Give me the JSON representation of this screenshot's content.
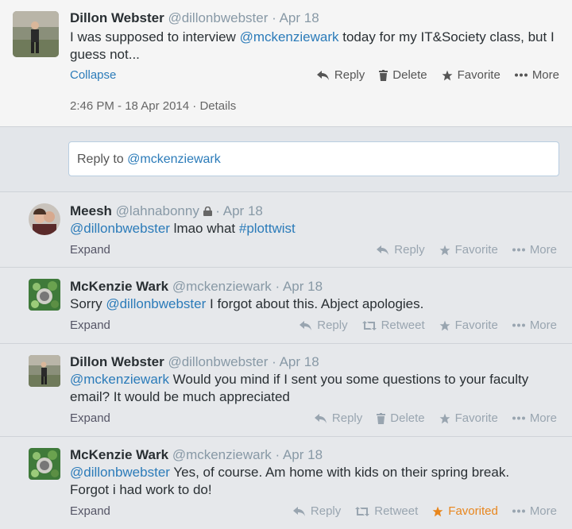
{
  "main": {
    "name": "Dillon Webster",
    "handle": "@dillonbwebster",
    "date": "Apr 18",
    "text_before": "I was supposed to interview ",
    "mention": "@mckenziewark",
    "text_after": " today for my IT&Society class, but I guess not...",
    "collapse": "Collapse",
    "actions": {
      "reply": "Reply",
      "delete": "Delete",
      "favorite": "Favorite",
      "more": "More"
    },
    "timestamp": "2:46 PM - 18 Apr 2014",
    "details": "Details"
  },
  "reply_box": {
    "prefix": "Reply to ",
    "mention": "@mckenziewark"
  },
  "replies": [
    {
      "name": "Meesh",
      "handle": "@lahnabonny",
      "date": "Apr 18",
      "locked": true,
      "mention": "@dillonbwebster",
      "text": " lmao what ",
      "hashtag": "#plottwist",
      "expand": "Expand",
      "actions": {
        "reply": "Reply",
        "favorite": "Favorite",
        "more": "More"
      }
    },
    {
      "name": "McKenzie Wark",
      "handle": "@mckenziewark",
      "date": "Apr 18",
      "pre": "Sorry ",
      "mention": "@dillonbwebster",
      "text": " I forgot about this. Abject apologies.",
      "expand": "Expand",
      "actions": {
        "reply": "Reply",
        "retweet": "Retweet",
        "favorite": "Favorite",
        "more": "More"
      }
    },
    {
      "name": "Dillon Webster",
      "handle": "@dillonbwebster",
      "date": "Apr 18",
      "mention": "@mckenziewark",
      "text": " Would you mind if I sent you some questions to your faculty email? It would be much appreciated",
      "expand": "Expand",
      "actions": {
        "reply": "Reply",
        "delete": "Delete",
        "favorite": "Favorite",
        "more": "More"
      }
    },
    {
      "name": "McKenzie Wark",
      "handle": "@mckenziewark",
      "date": "Apr 18",
      "mention": "@dillonbwebster",
      "text": " Yes, of course. Am home with kids on their spring break. Forgot i had work to do!",
      "expand": "Expand",
      "actions": {
        "reply": "Reply",
        "retweet": "Retweet",
        "favorited": "Favorited",
        "more": "More"
      }
    }
  ],
  "colors": {
    "link": "#2b7bb9",
    "favorited": "#e8861d",
    "muted": "#99a5b0"
  }
}
